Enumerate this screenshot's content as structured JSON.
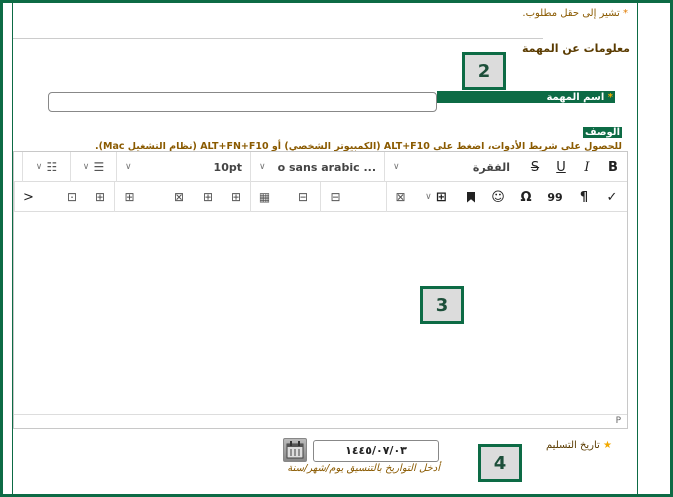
{
  "required_note": "تشير إلى حقل مطلوب.",
  "section_title": "معلومات عن المهمة",
  "callouts": [
    "2",
    "3",
    "4"
  ],
  "task_name": {
    "label": "اسم المهمة",
    "value": ""
  },
  "description": {
    "label": "الوصف",
    "hint": "للحصول على شريط الأدوات، اضغط على ALT+F10 (الكمبيوتر الشخصي) أو ALT+FN+F10 (نظام التشغيل Mac)."
  },
  "toolbar": {
    "row1": {
      "bold": "B",
      "italic": "I",
      "underline": "U",
      "strike": "S",
      "paragraph_format": "الفقرة",
      "font_family": "o sans arabic ...",
      "font_size": "10pt"
    },
    "row2": {
      "check": "✓",
      "pilcrow": "¶",
      "quote": "99",
      "omega": "Ω",
      "more": ">"
    }
  },
  "editor": {
    "content": "",
    "path": "P"
  },
  "due_date": {
    "label": "تاريخ التسليم",
    "value": "١٤٤٥/٠٧/٠٣",
    "hint": "أدخل التواريخ بالتنسيق يوم/شهر/سنة"
  },
  "colors": {
    "brand_green": "#0d6b45",
    "note_brown": "#8a5a00",
    "star_orange": "#f2a900"
  }
}
